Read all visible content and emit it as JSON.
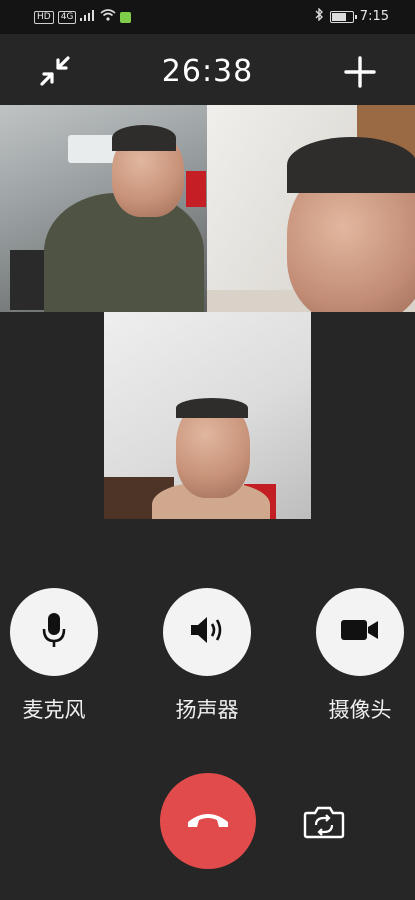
{
  "status_bar": {
    "left_badges": [
      "HD",
      "4G"
    ],
    "time": "7:15"
  },
  "call": {
    "duration": "26:38",
    "icons": {
      "minimize": "minimize-icon",
      "add": "plus-icon",
      "switch_camera": "camera-switch-icon",
      "hangup": "phone-hangup-icon"
    }
  },
  "participants": [
    {
      "name_hint": ""
    },
    {
      "name_hint": ""
    },
    {
      "name_hint": ""
    }
  ],
  "controls": {
    "microphone": {
      "label": "麦克风",
      "icon": "microphone-icon"
    },
    "speaker": {
      "label": "扬声器",
      "icon": "speaker-icon"
    },
    "camera": {
      "label": "摄像头",
      "icon": "video-camera-icon"
    }
  },
  "colors": {
    "background": "#262626",
    "hangup": "#e14b4b",
    "control_bg": "#f3f3f3"
  }
}
